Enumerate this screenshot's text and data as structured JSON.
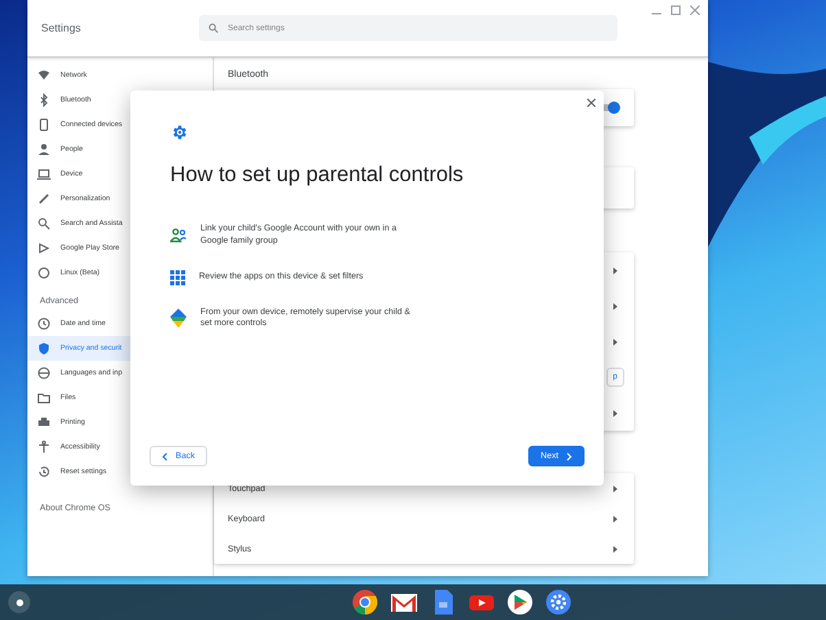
{
  "window": {
    "title": "Settings",
    "search": {
      "placeholder": "Search settings"
    }
  },
  "sidebar": {
    "items": [
      {
        "label": "Network",
        "selected": false
      },
      {
        "label": "Bluetooth",
        "selected": false
      },
      {
        "label": "Connected devices",
        "selected": false
      },
      {
        "label": "People",
        "selected": false
      },
      {
        "label": "Device",
        "selected": false
      },
      {
        "label": "Personalization",
        "selected": false
      },
      {
        "label": "Search and Assista",
        "selected": false
      },
      {
        "label": "Google Play Store",
        "selected": false
      },
      {
        "label": "Linux (Beta)",
        "selected": false
      }
    ],
    "advanced_heading": "Advanced",
    "advanced_items": [
      {
        "label": "Date and time",
        "selected": false
      },
      {
        "label": "Privacy and securit",
        "selected": true
      },
      {
        "label": "Languages and inp",
        "selected": false
      },
      {
        "label": "Files",
        "selected": false
      },
      {
        "label": "Printing",
        "selected": false
      },
      {
        "label": "Accessibility",
        "selected": false
      },
      {
        "label": "Reset settings",
        "selected": false
      }
    ],
    "about": "About Chrome OS"
  },
  "content": {
    "section_title": "Bluetooth",
    "cards": [
      {
        "rows": [
          {
            "kind": "toggle",
            "on": true
          }
        ]
      },
      {
        "rows": [
          {
            "kind": "blank"
          }
        ]
      },
      {
        "rows": [
          {
            "kind": "chevron"
          },
          {
            "kind": "chevron"
          },
          {
            "kind": "chevron"
          },
          {
            "kind": "button",
            "label": "p"
          },
          {
            "kind": "chevron"
          }
        ]
      },
      {
        "rows": [
          {
            "kind": "chevron",
            "label": "Touchpad"
          },
          {
            "kind": "chevron",
            "label": "Keyboard"
          },
          {
            "kind": "chevron",
            "label": "Stylus"
          }
        ]
      }
    ]
  },
  "dialog": {
    "title": "How to set up parental controls",
    "steps": [
      "Link your child's Google Account with your own in a Google family group",
      "Review the apps on this device & set filters",
      "From your own device, remotely supervise your child & set more controls"
    ],
    "back": "Back",
    "next": "Next"
  }
}
